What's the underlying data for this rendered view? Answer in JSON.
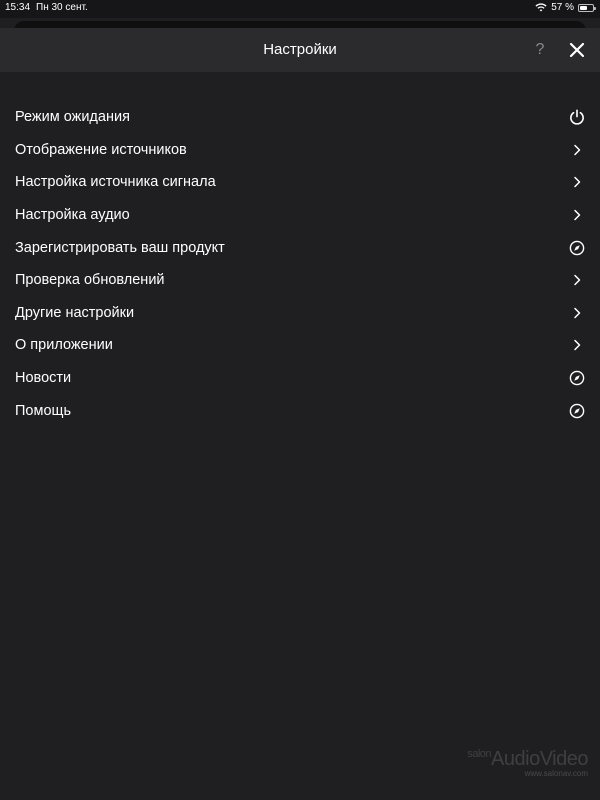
{
  "status_bar": {
    "time": "15:34",
    "date": "Пн 30 сент.",
    "battery": "57 %",
    "battery_level": 0.57
  },
  "header": {
    "title": "Настройки",
    "help_label": "?"
  },
  "menu": {
    "items": [
      {
        "label": "Режим ожидания",
        "icon": "power-icon"
      },
      {
        "label": "Отображение источников",
        "icon": "chevron-right-icon"
      },
      {
        "label": "Настройка источника сигнала",
        "icon": "chevron-right-icon"
      },
      {
        "label": "Настройка аудио",
        "icon": "chevron-right-icon"
      },
      {
        "label": "Зарегистрировать ваш продукт",
        "icon": "compass-icon"
      },
      {
        "label": "Проверка обновлений",
        "icon": "chevron-right-icon"
      },
      {
        "label": "Другие настройки",
        "icon": "chevron-right-icon"
      },
      {
        "label": "О приложении",
        "icon": "chevron-right-icon"
      },
      {
        "label": "Новости",
        "icon": "compass-icon"
      },
      {
        "label": "Помощь",
        "icon": "compass-icon"
      }
    ]
  },
  "watermark": {
    "logo_small": "salon",
    "logo": "AudioVideo",
    "site": "www.salonav.com"
  }
}
